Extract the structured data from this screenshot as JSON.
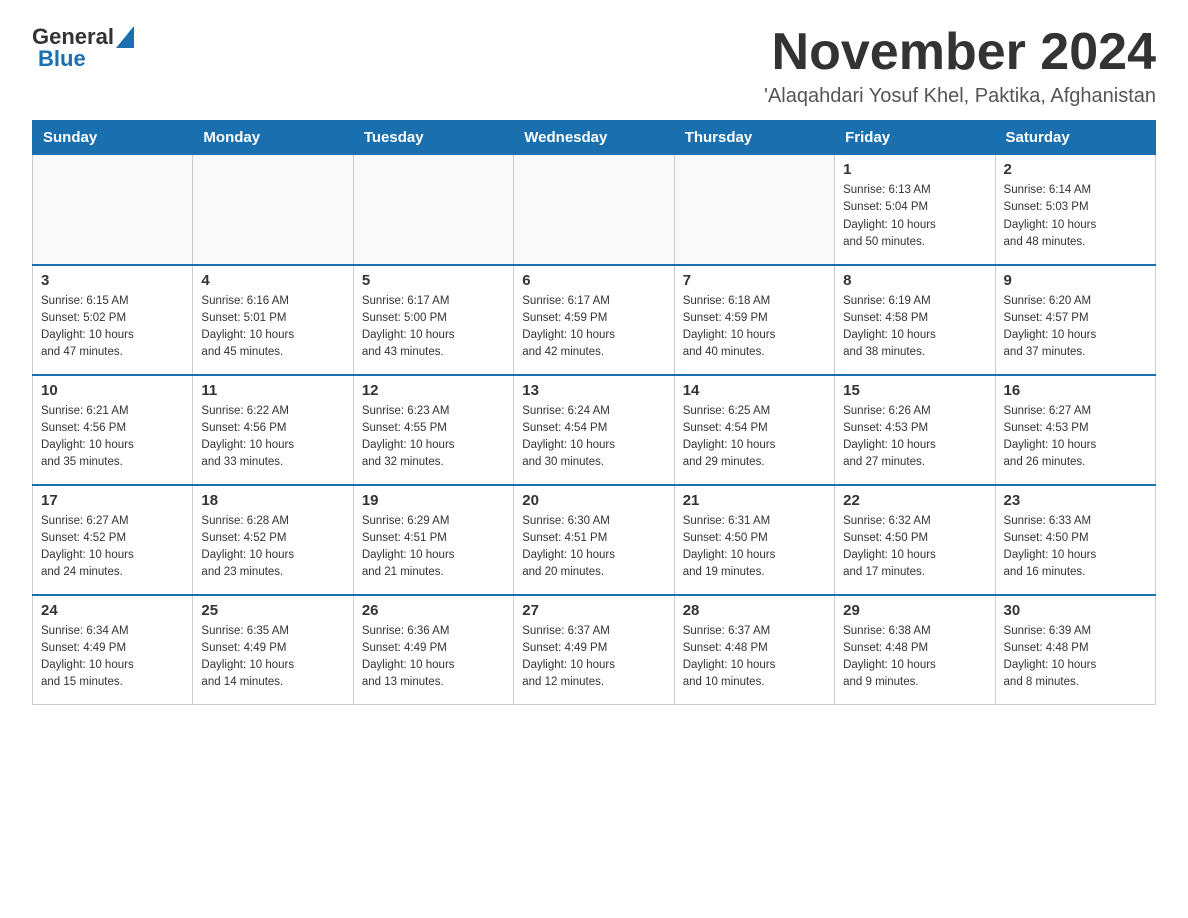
{
  "header": {
    "logo_general": "General",
    "logo_blue": "Blue",
    "month_title": "November 2024",
    "location": "'Alaqahdari Yosuf Khel, Paktika, Afghanistan"
  },
  "days_of_week": [
    "Sunday",
    "Monday",
    "Tuesday",
    "Wednesday",
    "Thursday",
    "Friday",
    "Saturday"
  ],
  "weeks": [
    [
      {
        "day": "",
        "info": ""
      },
      {
        "day": "",
        "info": ""
      },
      {
        "day": "",
        "info": ""
      },
      {
        "day": "",
        "info": ""
      },
      {
        "day": "",
        "info": ""
      },
      {
        "day": "1",
        "info": "Sunrise: 6:13 AM\nSunset: 5:04 PM\nDaylight: 10 hours\nand 50 minutes."
      },
      {
        "day": "2",
        "info": "Sunrise: 6:14 AM\nSunset: 5:03 PM\nDaylight: 10 hours\nand 48 minutes."
      }
    ],
    [
      {
        "day": "3",
        "info": "Sunrise: 6:15 AM\nSunset: 5:02 PM\nDaylight: 10 hours\nand 47 minutes."
      },
      {
        "day": "4",
        "info": "Sunrise: 6:16 AM\nSunset: 5:01 PM\nDaylight: 10 hours\nand 45 minutes."
      },
      {
        "day": "5",
        "info": "Sunrise: 6:17 AM\nSunset: 5:00 PM\nDaylight: 10 hours\nand 43 minutes."
      },
      {
        "day": "6",
        "info": "Sunrise: 6:17 AM\nSunset: 4:59 PM\nDaylight: 10 hours\nand 42 minutes."
      },
      {
        "day": "7",
        "info": "Sunrise: 6:18 AM\nSunset: 4:59 PM\nDaylight: 10 hours\nand 40 minutes."
      },
      {
        "day": "8",
        "info": "Sunrise: 6:19 AM\nSunset: 4:58 PM\nDaylight: 10 hours\nand 38 minutes."
      },
      {
        "day": "9",
        "info": "Sunrise: 6:20 AM\nSunset: 4:57 PM\nDaylight: 10 hours\nand 37 minutes."
      }
    ],
    [
      {
        "day": "10",
        "info": "Sunrise: 6:21 AM\nSunset: 4:56 PM\nDaylight: 10 hours\nand 35 minutes."
      },
      {
        "day": "11",
        "info": "Sunrise: 6:22 AM\nSunset: 4:56 PM\nDaylight: 10 hours\nand 33 minutes."
      },
      {
        "day": "12",
        "info": "Sunrise: 6:23 AM\nSunset: 4:55 PM\nDaylight: 10 hours\nand 32 minutes."
      },
      {
        "day": "13",
        "info": "Sunrise: 6:24 AM\nSunset: 4:54 PM\nDaylight: 10 hours\nand 30 minutes."
      },
      {
        "day": "14",
        "info": "Sunrise: 6:25 AM\nSunset: 4:54 PM\nDaylight: 10 hours\nand 29 minutes."
      },
      {
        "day": "15",
        "info": "Sunrise: 6:26 AM\nSunset: 4:53 PM\nDaylight: 10 hours\nand 27 minutes."
      },
      {
        "day": "16",
        "info": "Sunrise: 6:27 AM\nSunset: 4:53 PM\nDaylight: 10 hours\nand 26 minutes."
      }
    ],
    [
      {
        "day": "17",
        "info": "Sunrise: 6:27 AM\nSunset: 4:52 PM\nDaylight: 10 hours\nand 24 minutes."
      },
      {
        "day": "18",
        "info": "Sunrise: 6:28 AM\nSunset: 4:52 PM\nDaylight: 10 hours\nand 23 minutes."
      },
      {
        "day": "19",
        "info": "Sunrise: 6:29 AM\nSunset: 4:51 PM\nDaylight: 10 hours\nand 21 minutes."
      },
      {
        "day": "20",
        "info": "Sunrise: 6:30 AM\nSunset: 4:51 PM\nDaylight: 10 hours\nand 20 minutes."
      },
      {
        "day": "21",
        "info": "Sunrise: 6:31 AM\nSunset: 4:50 PM\nDaylight: 10 hours\nand 19 minutes."
      },
      {
        "day": "22",
        "info": "Sunrise: 6:32 AM\nSunset: 4:50 PM\nDaylight: 10 hours\nand 17 minutes."
      },
      {
        "day": "23",
        "info": "Sunrise: 6:33 AM\nSunset: 4:50 PM\nDaylight: 10 hours\nand 16 minutes."
      }
    ],
    [
      {
        "day": "24",
        "info": "Sunrise: 6:34 AM\nSunset: 4:49 PM\nDaylight: 10 hours\nand 15 minutes."
      },
      {
        "day": "25",
        "info": "Sunrise: 6:35 AM\nSunset: 4:49 PM\nDaylight: 10 hours\nand 14 minutes."
      },
      {
        "day": "26",
        "info": "Sunrise: 6:36 AM\nSunset: 4:49 PM\nDaylight: 10 hours\nand 13 minutes."
      },
      {
        "day": "27",
        "info": "Sunrise: 6:37 AM\nSunset: 4:49 PM\nDaylight: 10 hours\nand 12 minutes."
      },
      {
        "day": "28",
        "info": "Sunrise: 6:37 AM\nSunset: 4:48 PM\nDaylight: 10 hours\nand 10 minutes."
      },
      {
        "day": "29",
        "info": "Sunrise: 6:38 AM\nSunset: 4:48 PM\nDaylight: 10 hours\nand 9 minutes."
      },
      {
        "day": "30",
        "info": "Sunrise: 6:39 AM\nSunset: 4:48 PM\nDaylight: 10 hours\nand 8 minutes."
      }
    ]
  ]
}
